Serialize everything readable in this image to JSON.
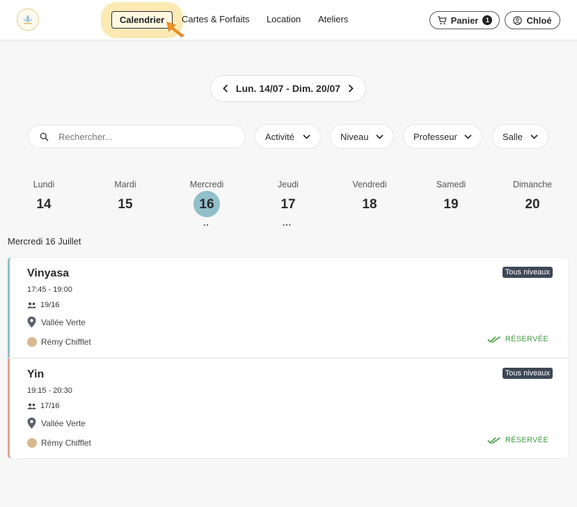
{
  "header": {
    "nav": [
      "Calendrier",
      "Cartes & Forfaits",
      "Location",
      "Ateliers"
    ],
    "cart_label": "Panier",
    "cart_count": "1",
    "user_label": "Chloé"
  },
  "week_range": "Lun. 14/07 - Dim. 20/07",
  "search": {
    "placeholder": "Rechercher..."
  },
  "filters": [
    "Activité",
    "Niveau",
    "Professeur",
    "Salle"
  ],
  "days": [
    {
      "name": "Lundi",
      "num": "14"
    },
    {
      "name": "Mardi",
      "num": "15"
    },
    {
      "name": "Mercredi",
      "num": "16"
    },
    {
      "name": "Jeudi",
      "num": "17"
    },
    {
      "name": "Vendredi",
      "num": "18"
    },
    {
      "name": "Samedi",
      "num": "19"
    },
    {
      "name": "Dimanche",
      "num": "20"
    }
  ],
  "selected_day": "16",
  "day_dots": {
    "16": "..",
    "17": "..."
  },
  "section_title": "Mercredi 16 Juillet",
  "classes": [
    {
      "title": "Vinyasa",
      "time": "17:45  -  19:00",
      "capacity": "19/16",
      "location": "Vallée Verte",
      "teacher": "Rémy Chifflet",
      "level": "Tous niveaux",
      "status": "RÉSERVÉE",
      "accent": "#8fbccb"
    },
    {
      "title": "Yin",
      "time": "19:15  -  20:30",
      "capacity": "17/16",
      "location": "Vallée Verte",
      "teacher": "Rémy Chifflet",
      "level": "Tous niveaux",
      "status": "RÉSERVÉE",
      "accent": "#e2a297"
    }
  ],
  "colors": {
    "selected_day": "#91bfca",
    "status": "#3e9b3e",
    "level_badge": "#3d4756",
    "highlight": "#fbe6a8"
  }
}
